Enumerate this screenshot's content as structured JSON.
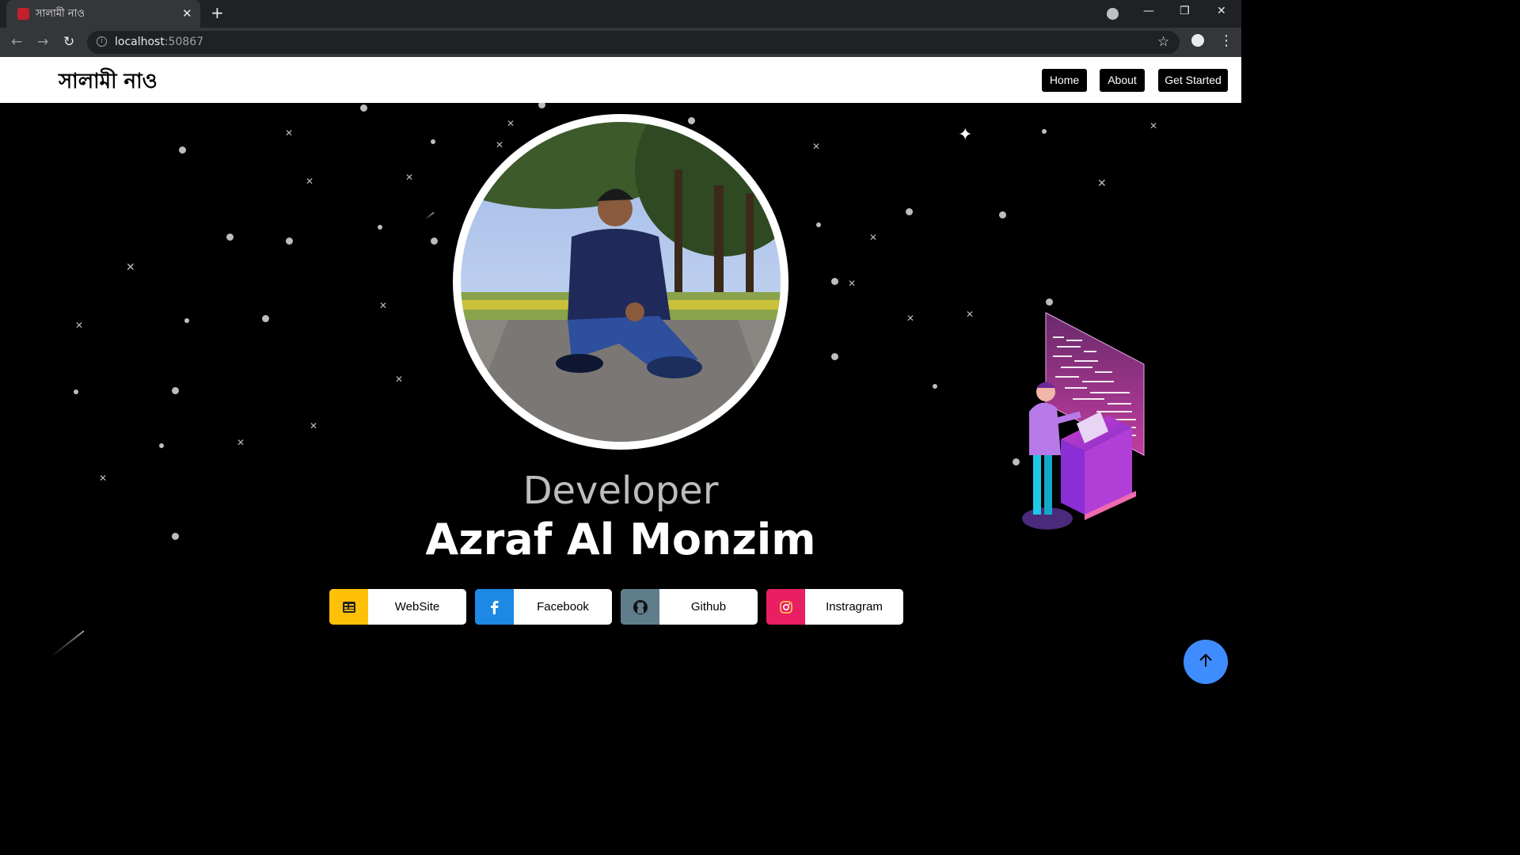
{
  "browser": {
    "tab_title": "সালামী নাও",
    "url_host": "localhost",
    "url_port": ":50867"
  },
  "site": {
    "logo": "সালামী নাও",
    "nav": {
      "home": "Home",
      "about": "About",
      "get_started": "Get Started"
    }
  },
  "hero": {
    "role": "Developer",
    "name": "Azraf Al Monzim",
    "links": {
      "website": "WebSite",
      "facebook": "Facebook",
      "github": "Github",
      "instagram": "Instragram"
    }
  },
  "colors": {
    "website_icon_bg": "#ffc107",
    "facebook_icon_bg": "#1e88e5",
    "github_icon_bg": "#607d8b",
    "instagram_icon_bg": "#e91e63",
    "scroll_top_bg": "#3f8cff"
  },
  "icons": {
    "tab_favicon": "app-icon",
    "website": "website-icon",
    "facebook": "facebook-icon",
    "github": "github-icon",
    "instagram": "instagram-icon",
    "scroll_top": "arrow-up-icon"
  }
}
